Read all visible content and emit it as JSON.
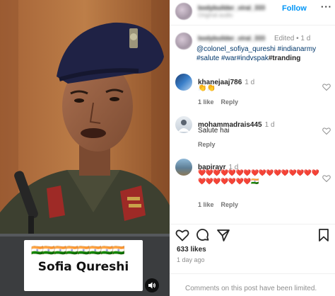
{
  "media": {
    "caption_flags": "🇮🇳🇮🇳🇮🇳🇮🇳🇮🇳🇮🇳🇮🇳🇮🇳",
    "caption_name": "Sofia Qureshi",
    "audio_icon": "speaker-icon"
  },
  "header": {
    "username": "bodybuilder_viral_333",
    "subtitle": "Original audio",
    "follow_label": "Follow",
    "more_icon": "more-dots-icon"
  },
  "caption": {
    "username": "bodybuilder_viral_333",
    "edited": "Edited",
    "time": "1 d",
    "tags": [
      "@colonel_sofiya_qureshi",
      "#indianarmy",
      "#salute",
      "#war",
      "#indvspak"
    ],
    "tag_plain": "#tranding"
  },
  "comments": [
    {
      "user": "khanejaaj786",
      "time": "1 d",
      "text": "👏👏",
      "replies_label": "1 like",
      "reply_label": "Reply"
    },
    {
      "user": "mohammadrais445",
      "time": "1 d",
      "text": "Salute hai",
      "reply_label": "Reply"
    },
    {
      "user": "bapirayr",
      "time": "1 d",
      "text": "❤️❤️❤️❤️❤️❤️❤️❤️❤️❤️❤️❤️❤️❤️❤️❤️❤️❤️❤️❤️❤️❤️❤️🇮🇳",
      "replies_label": "1 like",
      "reply_label": "Reply"
    }
  ],
  "actions": {
    "like_icon": "heart-icon",
    "comment_icon": "comment-icon",
    "share_icon": "share-icon",
    "save_icon": "bookmark-icon"
  },
  "likes": "633 likes",
  "posted": "1 day ago",
  "comments_limited": "Comments on this post have been limited.",
  "colors": {
    "accent": "#0095f6",
    "hashtag": "#00376b",
    "muted": "#8e8e8e"
  }
}
